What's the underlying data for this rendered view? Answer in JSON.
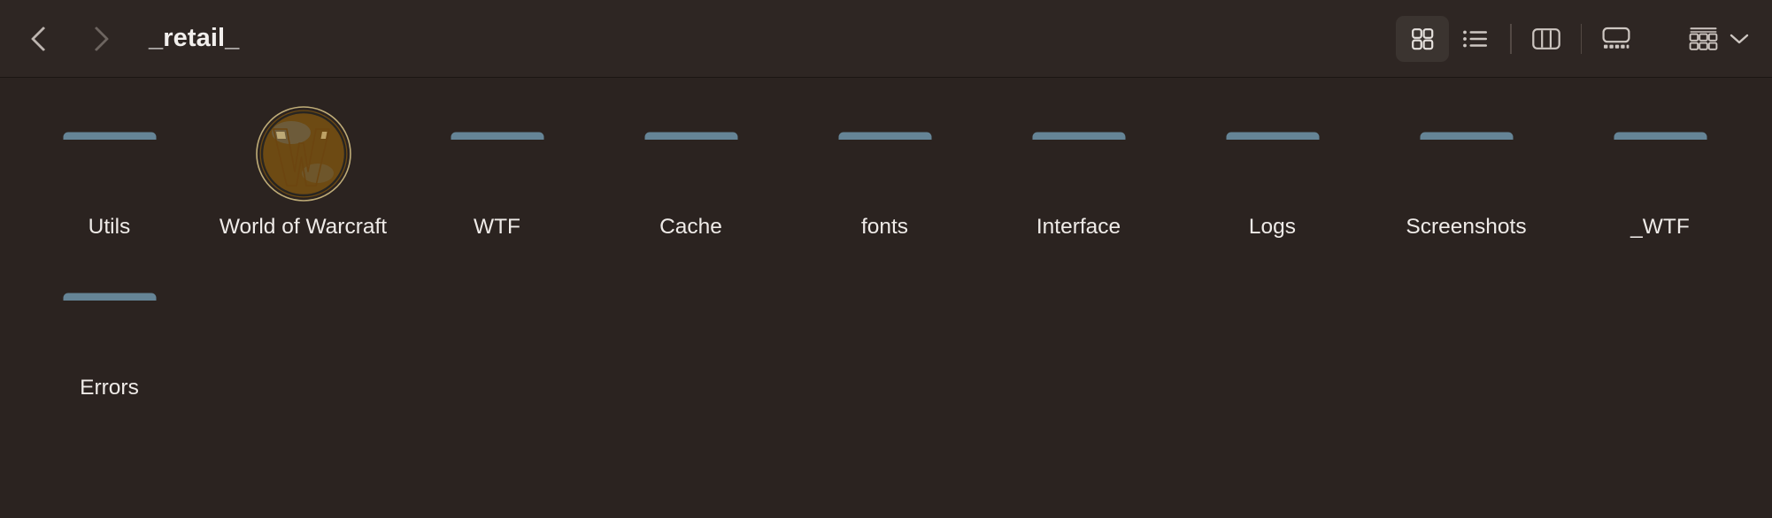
{
  "window": {
    "title": "_retail_",
    "background_color": "#2b2320",
    "toolbar_color": "#2e2623",
    "text_color": "#efebe8"
  },
  "toolbar": {
    "back_label": "Back",
    "forward_label": "Forward",
    "back_icon": "chevron-left-icon",
    "forward_icon": "chevron-right-icon",
    "view_buttons": [
      {
        "name": "icon-view",
        "label": "Icon View",
        "icon": "grid-four-squares-icon",
        "active": true
      },
      {
        "name": "list-view",
        "label": "List View",
        "icon": "bulleted-list-icon",
        "active": false
      },
      {
        "name": "column-view",
        "label": "Column View",
        "icon": "three-columns-icon",
        "active": false
      },
      {
        "name": "gallery-view",
        "label": "Gallery View",
        "icon": "gallery-filmstrip-icon",
        "active": false
      }
    ],
    "group_button": {
      "label": "Group",
      "icon": "group-items-icon",
      "chevron": "chevron-down-icon"
    }
  },
  "files": [
    {
      "name": "Utils",
      "type": "folder"
    },
    {
      "name": "World of Warcraft",
      "type": "app",
      "icon": "world-of-warcraft-icon"
    },
    {
      "name": "WTF",
      "type": "folder"
    },
    {
      "name": "Cache",
      "type": "folder"
    },
    {
      "name": "fonts",
      "type": "folder"
    },
    {
      "name": "Interface",
      "type": "folder"
    },
    {
      "name": "Logs",
      "type": "folder"
    },
    {
      "name": "Screenshots",
      "type": "folder"
    },
    {
      "name": "_WTF",
      "type": "folder"
    },
    {
      "name": "Errors",
      "type": "folder"
    }
  ],
  "colors": {
    "folder_body": "#74c4f4",
    "folder_edge": "#5aacdf",
    "folder_tab": "#7fcaf6",
    "accent_gold": "#d9a62e",
    "globe_blue": "#1d3b66"
  }
}
